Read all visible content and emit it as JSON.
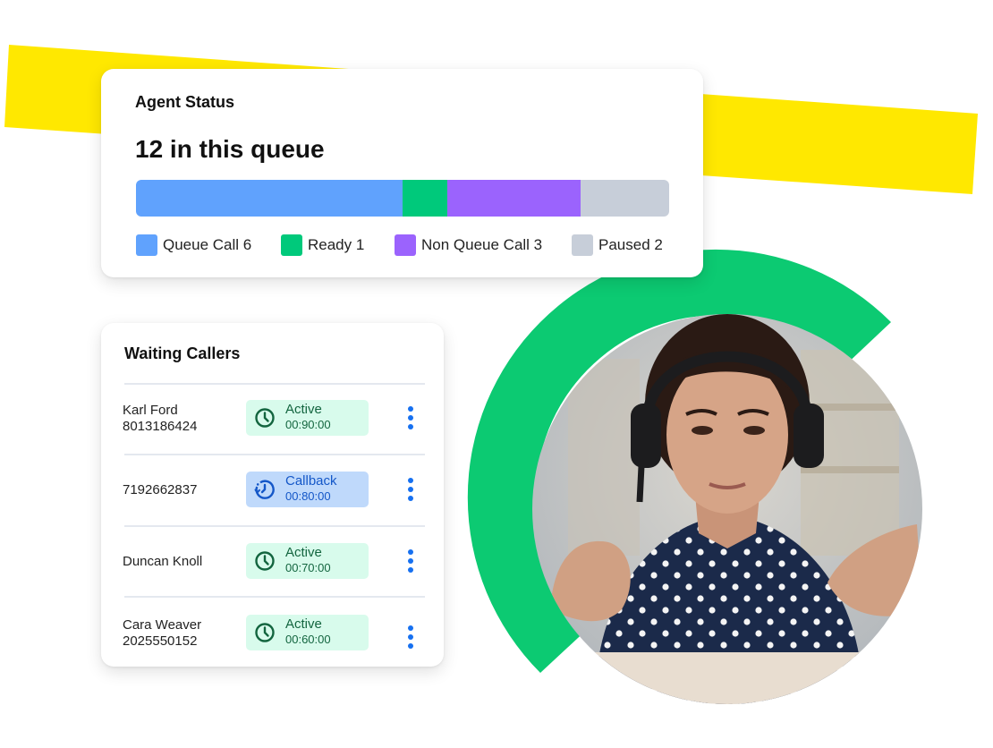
{
  "colors": {
    "yellow_band": "#ffe800",
    "green_arc": "#0cca72",
    "queue_call": "#60a2fd",
    "ready": "#00c97b",
    "non_queue_call": "#9b63fd",
    "paused": "#c7ced9",
    "more_dots": "#1670f0"
  },
  "agent_status": {
    "title": "Agent Status",
    "count_label": "12 in this queue",
    "total": 12,
    "segments": [
      {
        "key": "queue_call",
        "label": "Queue Call 6",
        "value": 6,
        "color": "#60a2fd"
      },
      {
        "key": "ready",
        "label": "Ready 1",
        "value": 1,
        "color": "#00c97b"
      },
      {
        "key": "non_queue_call",
        "label": "Non Queue Call 3",
        "value": 3,
        "color": "#9b63fd"
      },
      {
        "key": "paused",
        "label": "Paused 2",
        "value": 2,
        "color": "#c7ced9"
      }
    ]
  },
  "waiting_callers": {
    "title": "Waiting Callers",
    "rows": [
      {
        "name": "Karl Ford",
        "phone": "8013186424",
        "status": "Active",
        "time": "00:90:00",
        "type": "active",
        "icon": "clock-icon"
      },
      {
        "name": "",
        "phone": "7192662837",
        "status": "Callback",
        "time": "00:80:00",
        "type": "callback",
        "icon": "callback-clock-icon"
      },
      {
        "name": "Duncan Knoll",
        "phone": "",
        "status": "Active",
        "time": "00:70:00",
        "type": "active",
        "icon": "clock-icon"
      },
      {
        "name": "Cara Weaver",
        "phone": "2025550152",
        "status": "Active",
        "time": "00:60:00",
        "type": "active",
        "icon": "clock-icon"
      }
    ]
  },
  "photo": {
    "description": "Woman wearing headset gesturing at screen"
  }
}
